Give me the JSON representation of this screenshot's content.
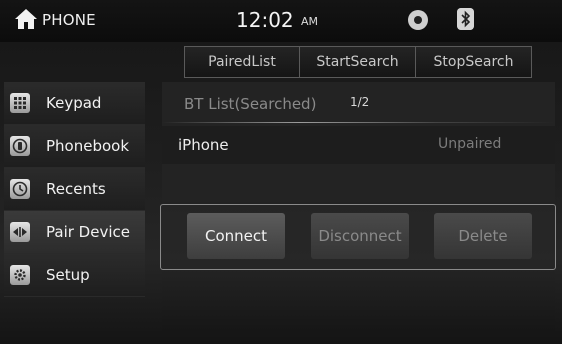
{
  "header": {
    "title": "PHONE",
    "time": "12:02",
    "ampm": "AM",
    "icons": [
      "home-icon",
      "disc-icon",
      "bluetooth-icon"
    ]
  },
  "tabs": [
    {
      "label": "PairedList"
    },
    {
      "label": "StartSearch"
    },
    {
      "label": "StopSearch"
    }
  ],
  "sidebar": {
    "items": [
      {
        "label": "Keypad",
        "icon": "keypad-icon"
      },
      {
        "label": "Phonebook",
        "icon": "phonebook-icon"
      },
      {
        "label": "Recents",
        "icon": "clock-icon"
      },
      {
        "label": "Pair Device",
        "icon": "pair-device-icon",
        "active": true
      },
      {
        "label": "Setup",
        "icon": "gear-icon"
      }
    ]
  },
  "list": {
    "heading": "BT List(Searched)",
    "page": "1/2",
    "rows": [
      {
        "name": "iPhone",
        "status": "Unpaired"
      }
    ]
  },
  "actions": {
    "connect": "Connect",
    "disconnect": "Disconnect",
    "delete": "Delete"
  },
  "colors": {
    "background": "#1b1b1b",
    "accent_text": "#f2f2f2",
    "disabled_text": "#8a8a8a"
  }
}
